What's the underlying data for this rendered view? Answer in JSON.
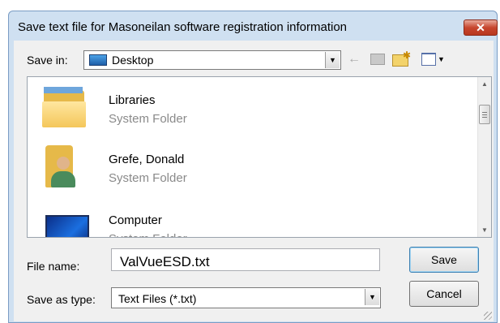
{
  "dialog": {
    "title": "Save text file for Masoneilan software registration information",
    "close_label": "✕"
  },
  "toolbar": {
    "save_in_label": "Save in:",
    "save_in_value": "Desktop"
  },
  "file_list": {
    "items": [
      {
        "name": "Libraries",
        "type": "System Folder",
        "icon": "libraries-folder-icon"
      },
      {
        "name": "Grefe, Donald",
        "type": "System Folder",
        "icon": "user-folder-icon"
      },
      {
        "name": "Computer",
        "type": "System Folder",
        "icon": "computer-icon"
      }
    ]
  },
  "form": {
    "file_name_label": "File name:",
    "file_name_value": "ValVueESD.txt",
    "save_as_type_label": "Save as type:",
    "save_as_type_value": "Text Files (*.txt)"
  },
  "buttons": {
    "save": "Save",
    "cancel": "Cancel"
  }
}
